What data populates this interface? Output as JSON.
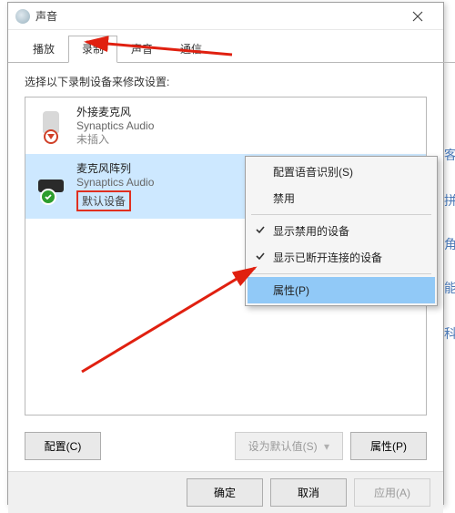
{
  "window": {
    "title": "声音"
  },
  "tabs": {
    "playback": "播放",
    "recording": "录制",
    "sounds": "声音",
    "communications": "通信"
  },
  "instruction": "选择以下录制设备来修改设置:",
  "devices": [
    {
      "name": "外接麦克风",
      "driver": "Synaptics Audio",
      "status": "未插入"
    },
    {
      "name": "麦克风阵列",
      "driver": "Synaptics Audio",
      "status_default": "默认设备"
    }
  ],
  "contextMenu": {
    "configSpeech": "配置语音识别(S)",
    "disable": "禁用",
    "showDisabled": "显示禁用的设备",
    "showDisconnected": "显示已断开连接的设备",
    "properties": "属性(P)"
  },
  "buttons": {
    "configure": "配置(C)",
    "setDefault": "设为默认值(S)",
    "properties": "属性(P)",
    "ok": "确定",
    "cancel": "取消",
    "apply": "应用(A)"
  },
  "sideFragments": [
    "客",
    "拼",
    "角",
    "能",
    "科"
  ]
}
